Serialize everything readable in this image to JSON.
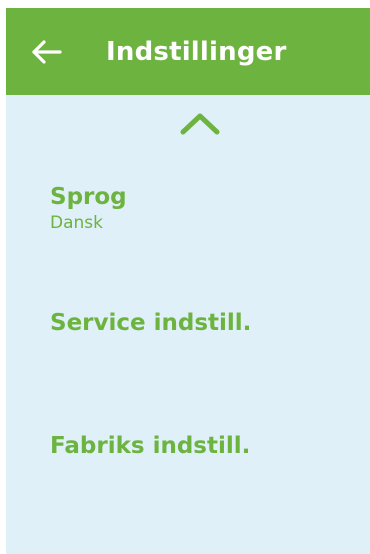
{
  "colors": {
    "accent": "#6db33f",
    "background": "#dff0f8",
    "header_text": "#ffffff"
  },
  "header": {
    "back_icon": "arrow-left-icon",
    "title": "Indstillinger"
  },
  "scroll_up_icon": "chevron-up-icon",
  "menu": {
    "items": [
      {
        "label": "Sprog",
        "value": "Dansk"
      },
      {
        "label": "Service indstill."
      },
      {
        "label": "Fabriks indstill."
      }
    ]
  }
}
